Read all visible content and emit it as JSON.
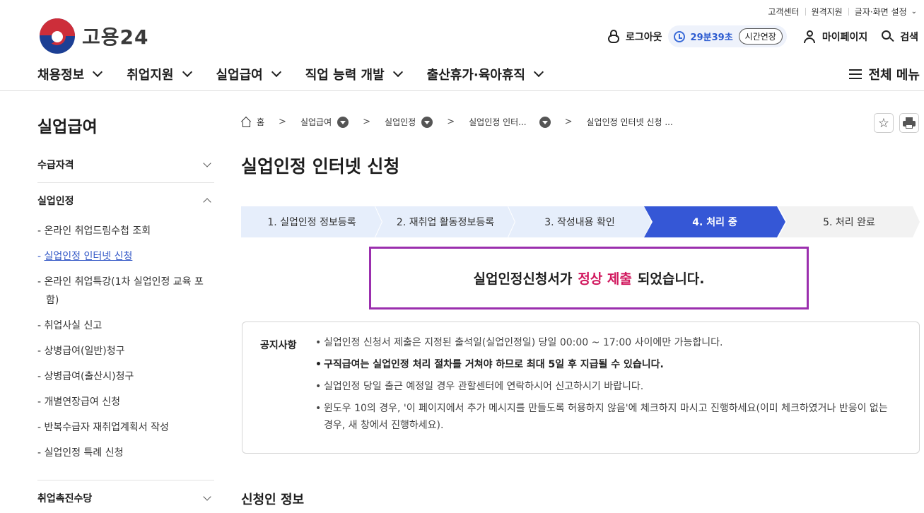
{
  "utility": {
    "items": [
      "고객센터",
      "원격지원",
      "글자·화면 설정"
    ]
  },
  "logo": {
    "text": "고용24"
  },
  "header": {
    "logout": "로그아웃",
    "timer": "29분39초",
    "extend": "시간연장",
    "mypage": "마이페이지",
    "search": "검색"
  },
  "gnb": {
    "items": [
      "채용정보",
      "취업지원",
      "실업급여",
      "직업 능력 개발",
      "출산휴가·육아휴직"
    ],
    "all_menu": "전체 메뉴"
  },
  "sidebar": {
    "title": "실업급여",
    "groups": [
      {
        "label": "수급자격"
      },
      {
        "label": "실업인정",
        "items": [
          "온라인 취업드림수첩 조회",
          "실업인정 인터넷 신청",
          "온라인 취업특강(1차 실업인정 교육 포함)",
          "취업사실 신고",
          "상병급여(일반)청구",
          "상병급여(출산시)청구",
          "개별연장급여 신청",
          "반복수급자 재취업계획서 작성",
          "실업인정 특례 신청"
        ]
      },
      {
        "label": "취업촉진수당"
      }
    ]
  },
  "breadcrumb": {
    "home": "홈",
    "items": [
      "실업급여",
      "실업인정",
      "실업인정 인터...",
      "실업인정 인터넷 신청 ..."
    ]
  },
  "page": {
    "title": "실업인정 인터넷 신청",
    "steps": [
      "1. 실업인정 정보등록",
      "2. 재취업 활동정보등록",
      "3. 작성내용 확인",
      "4. 처리 중",
      "5. 처리 완료"
    ],
    "current_step": 4,
    "message_pre": "실업인정신청서가",
    "message_hl": "정상 제출",
    "message_post": "되었습니다.",
    "notice_label": "공지사항",
    "notices": [
      "실업인정 신청서 제출은 지정된 출석일(실업인정일) 당일 00:00 ~ 17:00 사이에만 가능합니다.",
      "구직급여는 실업인정 처리 절차를 거쳐야 하므로 최대 5일 후 지급될 수 있습니다.",
      "실업인정 당일 출근 예정일 경우 관할센터에 연락하시어 신고하시기 바랍니다.",
      "윈도우 10의 경우, '이 페이지에서 추가 메시지를 만들도록 허용하지 않음'에 체크하지 마시고 진행하세요(이미 체크하였거나 반응이 없는 경우, 새 창에서 진행하세요)."
    ],
    "section_title": "신청인 정보"
  },
  "colors": {
    "step_current": "#3557d6",
    "step_done": "#e6eefb",
    "step_todo": "#f2f2f2",
    "highlight": "#d1185e",
    "frame": "#9b2fae"
  }
}
